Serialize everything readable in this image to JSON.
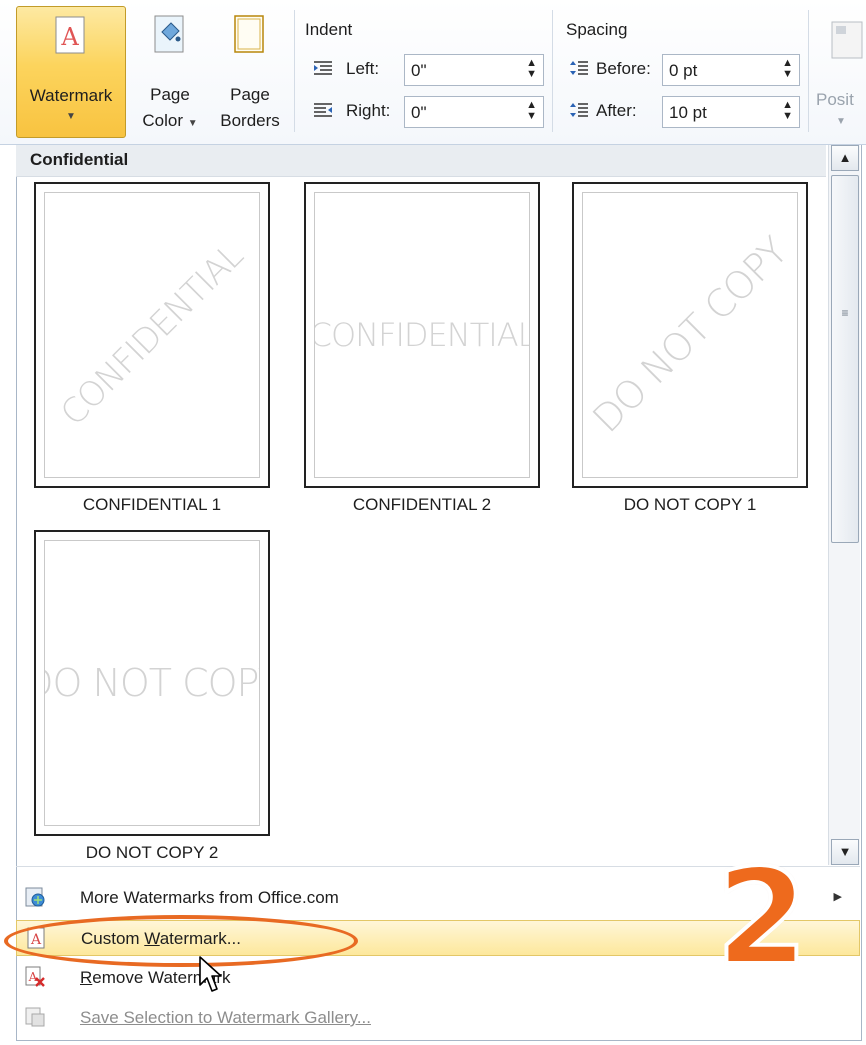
{
  "ribbon": {
    "watermark_label": "Watermark",
    "page_color_line1": "Page",
    "page_color_line2": "Color",
    "page_borders_line1": "Page",
    "page_borders_line2": "Borders",
    "indent": {
      "title": "Indent",
      "left_label": "Left:",
      "left_value": "0\"",
      "right_label": "Right:",
      "right_value": "0\""
    },
    "spacing": {
      "title": "Spacing",
      "before_label": "Before:",
      "before_value": "0 pt",
      "after_label": "After:",
      "after_value": "10 pt"
    },
    "position_label": "Posit"
  },
  "gallery": {
    "category": "Confidential",
    "items": [
      {
        "caption": "CONFIDENTIAL 1",
        "text": "CONFIDENTIAL",
        "style": "diagonal"
      },
      {
        "caption": "CONFIDENTIAL 2",
        "text": "CONFIDENTIAL",
        "style": "horizontal"
      },
      {
        "caption": "DO NOT COPY 1",
        "text": "DO NOT COPY",
        "style": "diagonal"
      },
      {
        "caption": "DO NOT COPY 2",
        "text": "DO NOT COPY",
        "style": "horizontal"
      }
    ]
  },
  "menu": {
    "more": "More Watermarks from Office.com",
    "custom_pre": "Custom ",
    "custom_key": "W",
    "custom_post": "atermark...",
    "remove_key": "R",
    "remove_post": "emove Watermark",
    "save": "Save Selection to Watermark Gallery..."
  },
  "annotation": {
    "step": "2",
    "color": "#ee6a1d"
  },
  "colors": {
    "hover": "#fde89c",
    "accent": "#f8c340"
  }
}
